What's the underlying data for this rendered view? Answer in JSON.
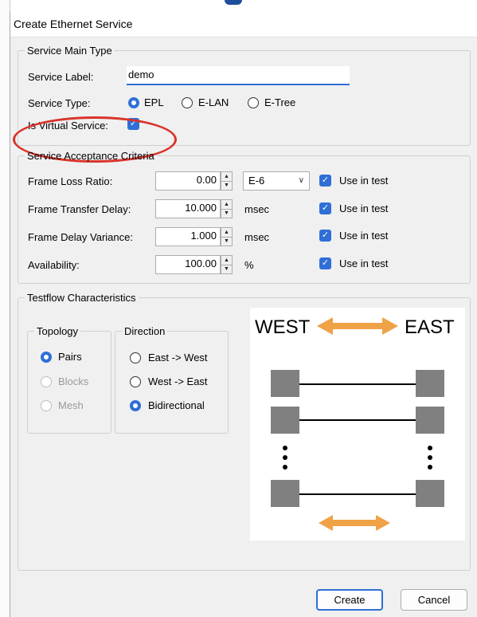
{
  "dialog": {
    "title": "Create Ethernet Service",
    "create_label": "Create",
    "cancel_label": "Cancel"
  },
  "main_type": {
    "legend": "Service Main Type",
    "service_label_label": "Service Label:",
    "service_label_value": "demo",
    "service_type_label": "Service Type:",
    "service_types": [
      "EPL",
      "E-LAN",
      "E-Tree"
    ],
    "selected_service_type": "EPL",
    "is_virtual_label": "Is Virtual Service:",
    "is_virtual_checked": true
  },
  "acceptance": {
    "legend": "Service Acceptance Criteria",
    "rows": [
      {
        "label": "Frame Loss Ratio:",
        "value": "0.00",
        "unit": "E-6",
        "use_label": "Use in test",
        "checked": true
      },
      {
        "label": "Frame Transfer Delay:",
        "value": "10.000",
        "unit": "msec",
        "use_label": "Use in test",
        "checked": true
      },
      {
        "label": "Frame Delay Variance:",
        "value": "1.000",
        "unit": "msec",
        "use_label": "Use in test",
        "checked": true
      },
      {
        "label": "Availability:",
        "value": "100.00",
        "unit": "%",
        "use_label": "Use in test",
        "checked": true
      }
    ]
  },
  "testflow": {
    "legend": "Testflow Characteristics",
    "topology": {
      "legend": "Topology",
      "options": [
        "Pairs",
        "Blocks",
        "Mesh"
      ],
      "selected": "Pairs"
    },
    "direction": {
      "legend": "Direction",
      "options": [
        "East -> West",
        "West -> East",
        "Bidirectional"
      ],
      "selected": "Bidirectional"
    },
    "diagram": {
      "west_label": "WEST",
      "east_label": "EAST",
      "arrow_color": "#f0a247",
      "node_color": "#808080"
    }
  },
  "colors": {
    "accent": "#2f6fd6",
    "annotation": "#d9342b"
  }
}
